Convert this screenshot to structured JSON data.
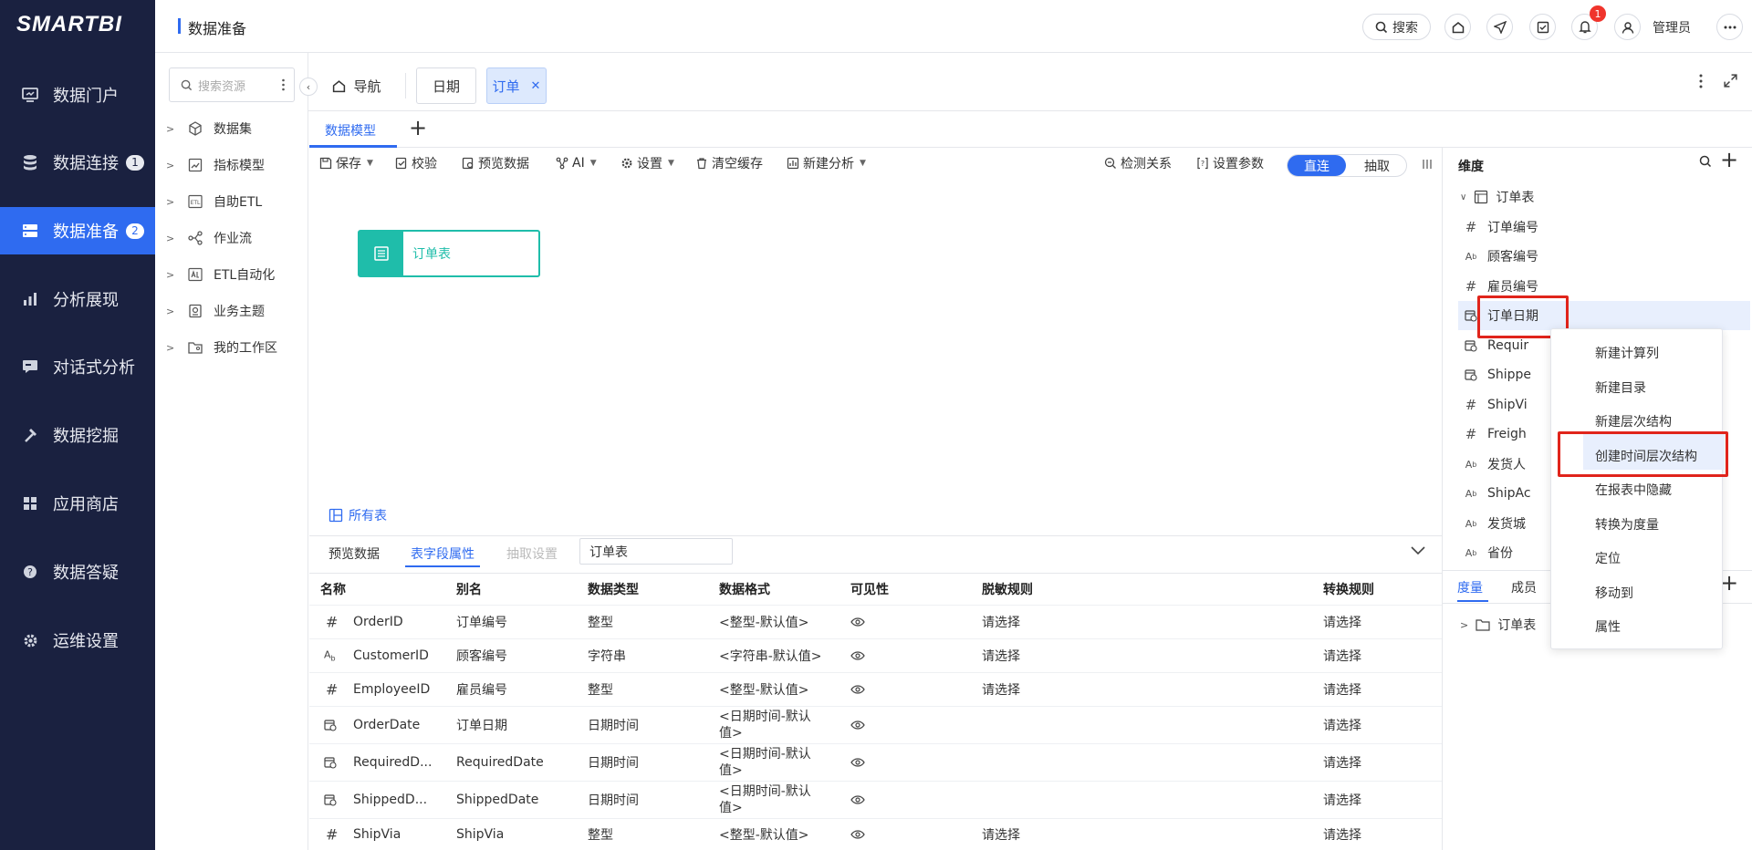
{
  "brand": "SMARTBI",
  "nav": [
    {
      "label": "数据门户",
      "badge": ""
    },
    {
      "label": "数据连接",
      "badge": "1"
    },
    {
      "label": "数据准备",
      "badge": "2"
    },
    {
      "label": "分析展现",
      "badge": ""
    },
    {
      "label": "对话式分析",
      "badge": ""
    },
    {
      "label": "数据挖掘",
      "badge": ""
    },
    {
      "label": "应用商店",
      "badge": ""
    },
    {
      "label": "数据答疑",
      "badge": ""
    },
    {
      "label": "运维设置",
      "badge": ""
    }
  ],
  "header": {
    "title": "数据准备",
    "search": "搜索",
    "notif_count": "1",
    "user": "管理员"
  },
  "tree": {
    "search_placeholder": "搜索资源",
    "items": [
      "数据集",
      "指标模型",
      "自助ETL",
      "作业流",
      "ETL自动化",
      "业务主题",
      "我的工作区"
    ]
  },
  "tabs": {
    "home": "导航",
    "date": "日期",
    "order": "订单"
  },
  "subtab": "数据模型",
  "toolbar": {
    "save": "保存",
    "check": "校验",
    "preview": "预览数据",
    "ai": "AI",
    "settings": "设置",
    "clear_cache": "清空缓存",
    "new_analysis": "新建分析",
    "detect": "检测关系",
    "params": "设置参数",
    "direct": "直连",
    "extract": "抽取"
  },
  "canvas": {
    "node": "订单表",
    "all_tables": "所有表"
  },
  "bottom": {
    "tabs": [
      "预览数据",
      "表字段属性",
      "抽取设置"
    ],
    "table_select": "订单表",
    "headers": [
      "名称",
      "别名",
      "数据类型",
      "数据格式",
      "可见性",
      "脱敏规则",
      "转换规则"
    ],
    "rows": [
      {
        "name": "OrderID",
        "alias": "订单编号",
        "type": "整型",
        "format": "<整型-默认值>",
        "mask": "请选择",
        "convert": "请选择",
        "icon": "hash"
      },
      {
        "name": "CustomerID",
        "alias": "顾客编号",
        "type": "字符串",
        "format": "<字符串-默认值>",
        "mask": "请选择",
        "convert": "请选择",
        "icon": "text"
      },
      {
        "name": "EmployeeID",
        "alias": "雇员编号",
        "type": "整型",
        "format": "<整型-默认值>",
        "mask": "请选择",
        "convert": "请选择",
        "icon": "hash"
      },
      {
        "name": "OrderDate",
        "alias": "订单日期",
        "type": "日期时间",
        "format": "<日期时间-默认值>",
        "mask": "",
        "convert": "请选择",
        "icon": "date"
      },
      {
        "name": "RequiredD...",
        "alias": "RequiredDate",
        "type": "日期时间",
        "format": "<日期时间-默认值>",
        "mask": "",
        "convert": "请选择",
        "icon": "date"
      },
      {
        "name": "ShippedD...",
        "alias": "ShippedDate",
        "type": "日期时间",
        "format": "<日期时间-默认值>",
        "mask": "",
        "convert": "请选择",
        "icon": "date"
      },
      {
        "name": "ShipVia",
        "alias": "ShipVia",
        "type": "整型",
        "format": "<整型-默认值>",
        "mask": "请选择",
        "convert": "请选择",
        "icon": "hash"
      }
    ]
  },
  "dims": {
    "title": "维度",
    "table": "订单表",
    "fields": [
      {
        "label": "订单编号",
        "icon": "hash"
      },
      {
        "label": "顾客编号",
        "icon": "text"
      },
      {
        "label": "雇员编号",
        "icon": "hash"
      },
      {
        "label": "订单日期",
        "icon": "date"
      },
      {
        "label": "Requir",
        "icon": "date"
      },
      {
        "label": "Shippe",
        "icon": "date"
      },
      {
        "label": "ShipVi",
        "icon": "hash"
      },
      {
        "label": "Freigh",
        "icon": "hash"
      },
      {
        "label": "发货人",
        "icon": "text"
      },
      {
        "label": "ShipAc",
        "icon": "text"
      },
      {
        "label": "发货城",
        "icon": "text"
      },
      {
        "label": "省份",
        "icon": "text"
      }
    ]
  },
  "measures": {
    "tab1": "度量",
    "tab2": "成员",
    "table": "订单表"
  },
  "context_menu": [
    "新建计算列",
    "新建目录",
    "新建层次结构",
    "创建时间层次结构",
    "在报表中隐藏",
    "转换为度量",
    "定位",
    "移动到",
    "属性"
  ],
  "colors": {
    "sidebar": "#1a2140",
    "accent": "#2f6bf0",
    "teal": "#1fbdaa",
    "highlight": "#e0241b"
  }
}
